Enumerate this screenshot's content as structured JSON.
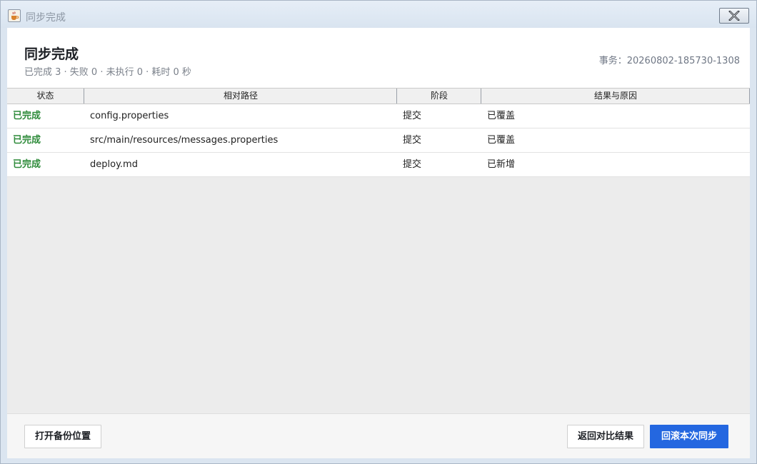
{
  "window": {
    "title": "同步完成",
    "app_icon": "java-cup-icon",
    "close_icon": "close-icon"
  },
  "header": {
    "title": "同步完成",
    "summary": "已完成 3 · 失败 0 · 未执行 0 · 耗时 0 秒",
    "transaction": "事务：20260802-185730-1308"
  },
  "table": {
    "columns": [
      "状态",
      "相对路径",
      "阶段",
      "结果与原因"
    ],
    "rows": [
      {
        "status": "已完成",
        "path": "config.properties",
        "stage": "提交",
        "result": "已覆盖"
      },
      {
        "status": "已完成",
        "path": "src/main/resources/messages.properties",
        "stage": "提交",
        "result": "已覆盖"
      },
      {
        "status": "已完成",
        "path": "deploy.md",
        "stage": "提交",
        "result": "已新增"
      }
    ],
    "status_color": "#2e8b3a"
  },
  "footer": {
    "open_backup_label": "打开备份位置",
    "back_compare_label": "返回对比结果",
    "rollback_label": "回滚本次同步"
  },
  "colors": {
    "primary": "#2467e0",
    "header_bg": "#ffffff",
    "body_bg": "#ececec"
  }
}
